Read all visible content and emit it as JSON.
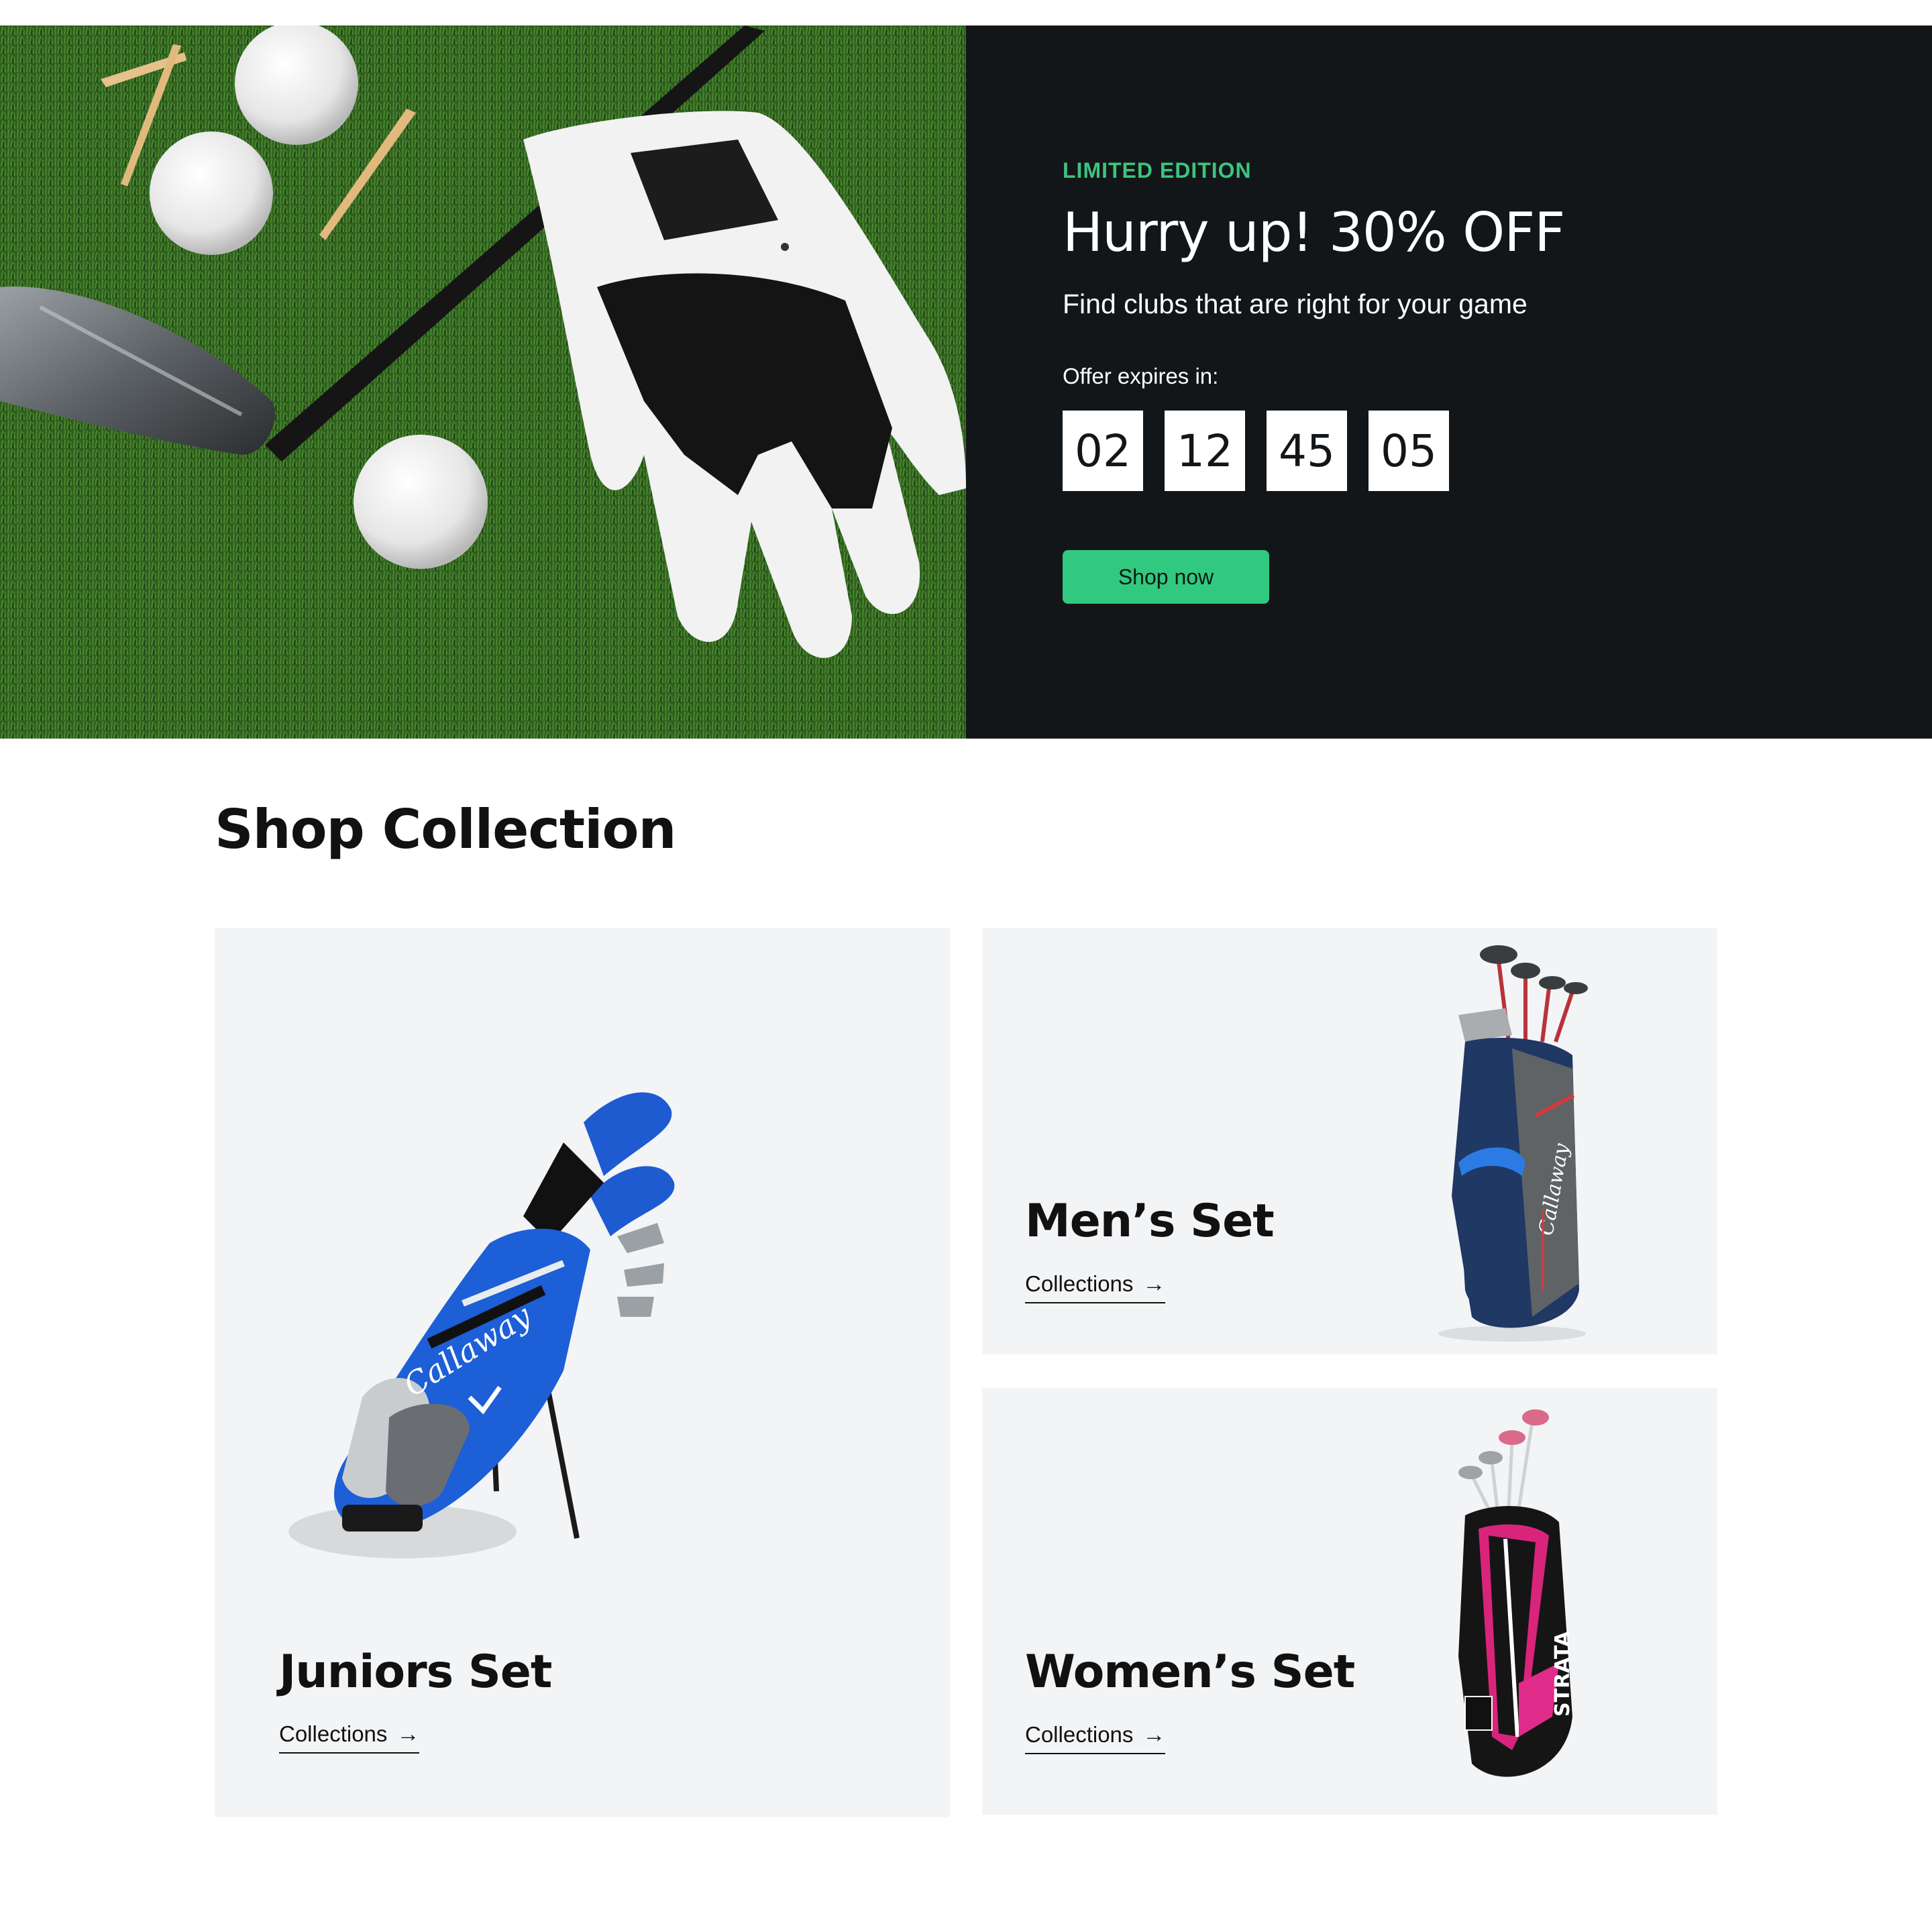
{
  "hero": {
    "eyebrow": "LIMITED EDITION",
    "title": "Hurry up! 30% OFF",
    "subtitle": "Find clubs that are right for your game",
    "expires_label": "Offer expires in:",
    "countdown": [
      "02",
      "12",
      "45",
      "05"
    ],
    "cta_label": "Shop now",
    "accent_color": "#31c97f",
    "panel_color": "#131618"
  },
  "collection": {
    "title": "Shop Collection",
    "cards": [
      {
        "title": "Juniors Set",
        "link_label": "Collections",
        "link_icon": "arrow-right-icon"
      },
      {
        "title": "Men’s Set",
        "link_label": "Collections",
        "link_icon": "arrow-right-icon"
      },
      {
        "title": "Women’s Set",
        "link_label": "Collections",
        "link_icon": "arrow-right-icon"
      }
    ],
    "card_background": "#f3f4f6"
  }
}
